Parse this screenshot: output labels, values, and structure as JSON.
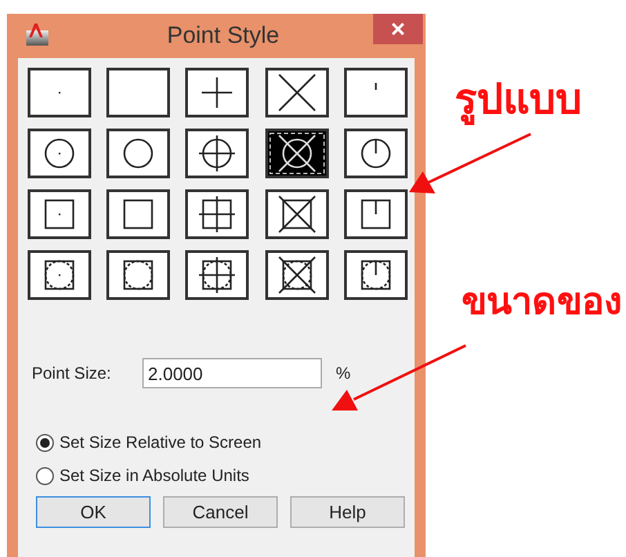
{
  "window": {
    "title": "Point Style",
    "close": "×"
  },
  "point_styles": [
    {
      "circle": false,
      "square": false,
      "styles": [
        {
          "kind": "dot",
          "selected": false
        },
        {
          "kind": "blank",
          "selected": false
        },
        {
          "kind": "plus",
          "selected": false
        },
        {
          "kind": "x",
          "selected": false
        },
        {
          "kind": "tick",
          "selected": false
        }
      ]
    },
    {
      "circle": true,
      "square": false,
      "styles": [
        {
          "kind": "dot",
          "selected": false
        },
        {
          "kind": "blank",
          "selected": false
        },
        {
          "kind": "plus",
          "selected": false
        },
        {
          "kind": "x",
          "selected": true
        },
        {
          "kind": "tick",
          "selected": false
        }
      ]
    },
    {
      "circle": false,
      "square": true,
      "styles": [
        {
          "kind": "dot",
          "selected": false
        },
        {
          "kind": "blank",
          "selected": false
        },
        {
          "kind": "plus",
          "selected": false
        },
        {
          "kind": "x",
          "selected": false
        },
        {
          "kind": "tick",
          "selected": false
        }
      ]
    },
    {
      "circle": true,
      "square": true,
      "styles": [
        {
          "kind": "dot",
          "selected": false
        },
        {
          "kind": "blank",
          "selected": false
        },
        {
          "kind": "plus",
          "selected": false
        },
        {
          "kind": "x",
          "selected": false
        },
        {
          "kind": "tick",
          "selected": false
        }
      ]
    }
  ],
  "point_size": {
    "label": "Point Size:",
    "value": "2.0000",
    "unit": "%"
  },
  "size_mode": [
    {
      "label": "Set Size Relative to Screen",
      "selected": true
    },
    {
      "label": "Set Size in Absolute Units",
      "selected": false
    }
  ],
  "buttons": [
    {
      "label": "OK",
      "default": true
    },
    {
      "label": "Cancel",
      "default": false
    },
    {
      "label": "Help",
      "default": false
    }
  ],
  "annotations": [
    {
      "text": "รูปแบบ"
    },
    {
      "text": "ขนาดของ"
    }
  ]
}
